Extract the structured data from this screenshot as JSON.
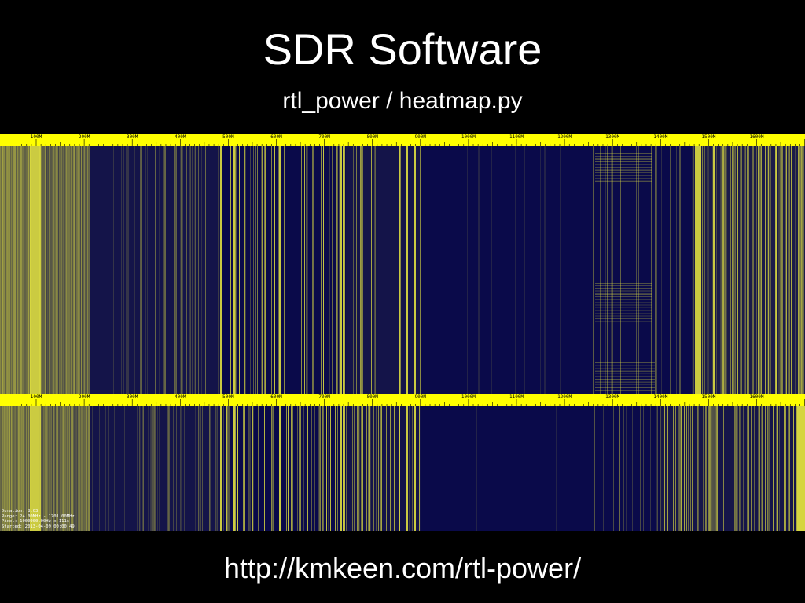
{
  "slide": {
    "title": "SDR Software",
    "subtitle": "rtl_power / heatmap.py",
    "url": "http://kmkeen.com/rtl-power/"
  },
  "heatmap": {
    "colors": {
      "background": "#0a0a4a",
      "signal": "#e0e040",
      "scale": "#ffff00",
      "tick_text": "#000000"
    },
    "scale_labels": [
      "100M",
      "200M",
      "300M",
      "400M",
      "500M",
      "600M",
      "700M",
      "800M",
      "900M",
      "1000M",
      "1100M",
      "1200M",
      "1300M",
      "1400M",
      "1500M",
      "1600M"
    ],
    "info": {
      "duration": "Duration: 8:03",
      "range": "Range: 24.00MHz - 1701.00MHz",
      "pixel": "Pixel: 1000000.00Hz x 111s",
      "started": "Started: 2013-04-09 00:00:49"
    }
  }
}
